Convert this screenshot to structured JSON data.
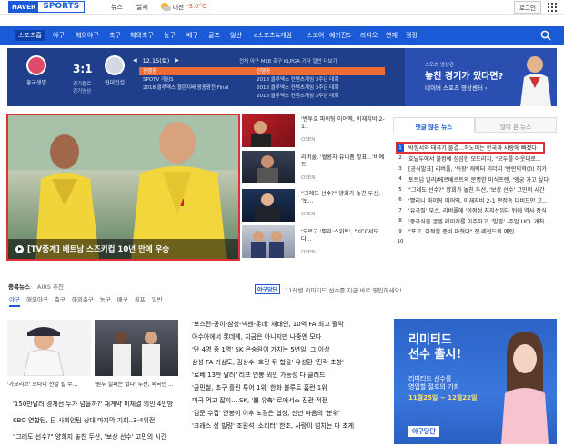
{
  "header": {
    "logo_naver": "NAVER",
    "logo_sports": "SPORTS",
    "links": [
      "뉴스",
      "날씨"
    ],
    "weather_city": "대전",
    "weather_temp": "-3.0°C",
    "login": "로그인"
  },
  "nav": {
    "items": [
      "스포츠홈",
      "야구",
      "해외야구",
      "축구",
      "해외축구",
      "농구",
      "배구",
      "골프",
      "일반",
      "e스포츠&게임",
      "스코어",
      "예거진S",
      "라디오",
      "연재",
      "랭킹"
    ],
    "active_index": 0
  },
  "scoreboard": {
    "home_team": "흥국생명",
    "away_team": "현대건설",
    "score": "3:1",
    "sub1": "경기종료",
    "sub2": "경기영상",
    "date": "12.15(토)",
    "filters": "전체  야구  MLB  축구  KLPGA  기타  일반  더보기",
    "board": [
      {
        "c1": "진행중",
        "c2": "진행중"
      },
      {
        "c1": "SPOTV 게임S",
        "c2": "2018 클루엑스 컨텐츠게임 3주년 대회"
      },
      {
        "c1": "2018 클루엑스 챌린지배 왕중왕전 Final",
        "c2": "2018 클루엑스 컨텐츠게임 3주년 대회"
      },
      {
        "c1": "",
        "c2": "2018 클루엑스 컨텐츠게임 3주년 대회"
      }
    ],
    "promo_small": "스포츠 영상관",
    "promo_big": "놓친 경기가 있다면?",
    "promo_sub": "네이버 스포츠 영상센터 ›"
  },
  "main_story": {
    "caption": "[TV중계] 베트남 스즈키컵 10년 만에 우승",
    "colors": {
      "border": "#e0303a"
    }
  },
  "thumbs": [
    {
      "text": "'벤투호 파이팅 이어엑, 이재지비 2-1..",
      "source": "OSEN"
    },
    {
      "text": "리버풀, '월룡자 유니폼 발표...'비예트",
      "source": "OSEN"
    },
    {
      "text": "\"그레도 선수?\" 양희가 놓친 두산, '보...",
      "source": "OSEN"
    },
    {
      "text": "'오르고 '뿌리:스위트', \"KCC서도 다...",
      "source": "OSEN"
    }
  ],
  "right_news": {
    "tabs": [
      "댓글 많은 뉴스",
      "많이 본 뉴스"
    ],
    "items": [
      "박항서와 태극기 물결...허노이는 한국과 사랑에 빠졌다",
      "호날두에서 불컹에 섬섬한 모드리치, \"모두를 아웃대로...",
      "[공식발표] 리버풀, '뉘장' 캐릭터 리더지 '반란의학(0) 허가",
      "토트넘 알리/베르베르트의 분명한 미식프렌, '앵궁 가고 싶다'",
      "\"그레도 선수?\" 양희가 놓친 두산, '보상 선수' 고민의 시간",
      "'빨리니 파이팅 이어엑, 이재지비 2-1 판정승 다비드만 고...",
      "'유국질' 부스, 리버풀에 '이점성 지지선임다 뒤에 역사 장식",
      "'중국식물 굴텔 레이캐를 이주하고, '발팔' -주말 UCL 개최 ...",
      "\"포고, 이적할 준비 마쳤다\" 전 레전드의 예인",
      ""
    ]
  },
  "bottom": {
    "head": [
      "종목뉴스",
      "AIRS 추천"
    ],
    "tabs": [
      "야구",
      "해외야구",
      "축구",
      "해외축구",
      "농구",
      "배구",
      "골프",
      "일반"
    ],
    "ygd_logo": "야구당단",
    "ygd_text": "11레벨 리미티드 선수를 지금 바로 영입하세요!",
    "thumb_caps": [
      "'가요리코' 오타니 선발 될 수...",
      "'원두 실패는 없다' 두산, 외국인 ..."
    ],
    "left_list": [
      "'150만달러 경계선 누가 넘을까?' 재계약 미체결 외인 4인방",
      "KBO 연합팀, 日 사회인팀 상대 마지막 기회..3-4위전",
      "\"그레도 선수?\" 양희지 놓친 두산, '보상 선수' 고민의 시간"
    ],
    "mid_list": [
      "'보스턴-공이-삼성-넥센-롯데' 채태인, 10억 FA 최고 활약",
      "아수아에서 롯데웨, 지금은 아니지만 나중엔 모다",
      "'단 4명 중 1명' SK 은숭원이 가치는 5년일, 그 이상",
      "삼성 FA 기삼도, 김상수 '흐릿 뒤 합을' 유성환 '진락 초항'",
      "'로베 13만 달러' 리프 연봉 외인 가능성 다 클러드",
      "'금민철, 초구 흘린 투어 1위' 한화 불루트 홈런 1위",
      "미국 먹고 잡이... SK, '뽑 유축' 로에서스 진관 적전",
      "'김준 수집' 연봉이 이후 노경은 협상, 신년 마음의 '분위'",
      "'크래스 성 빌렁' 조원석 '소리터' 한조, 사랑이 넘치는 다 초게"
    ],
    "ad": {
      "title1": "리미티드",
      "title2": "선수 출시!",
      "sub1": "리미티드 선수를",
      "sub2": "영입할 절호의 기회",
      "date": "11월25일 ~ 12월22일",
      "logo": "야구당단"
    }
  }
}
